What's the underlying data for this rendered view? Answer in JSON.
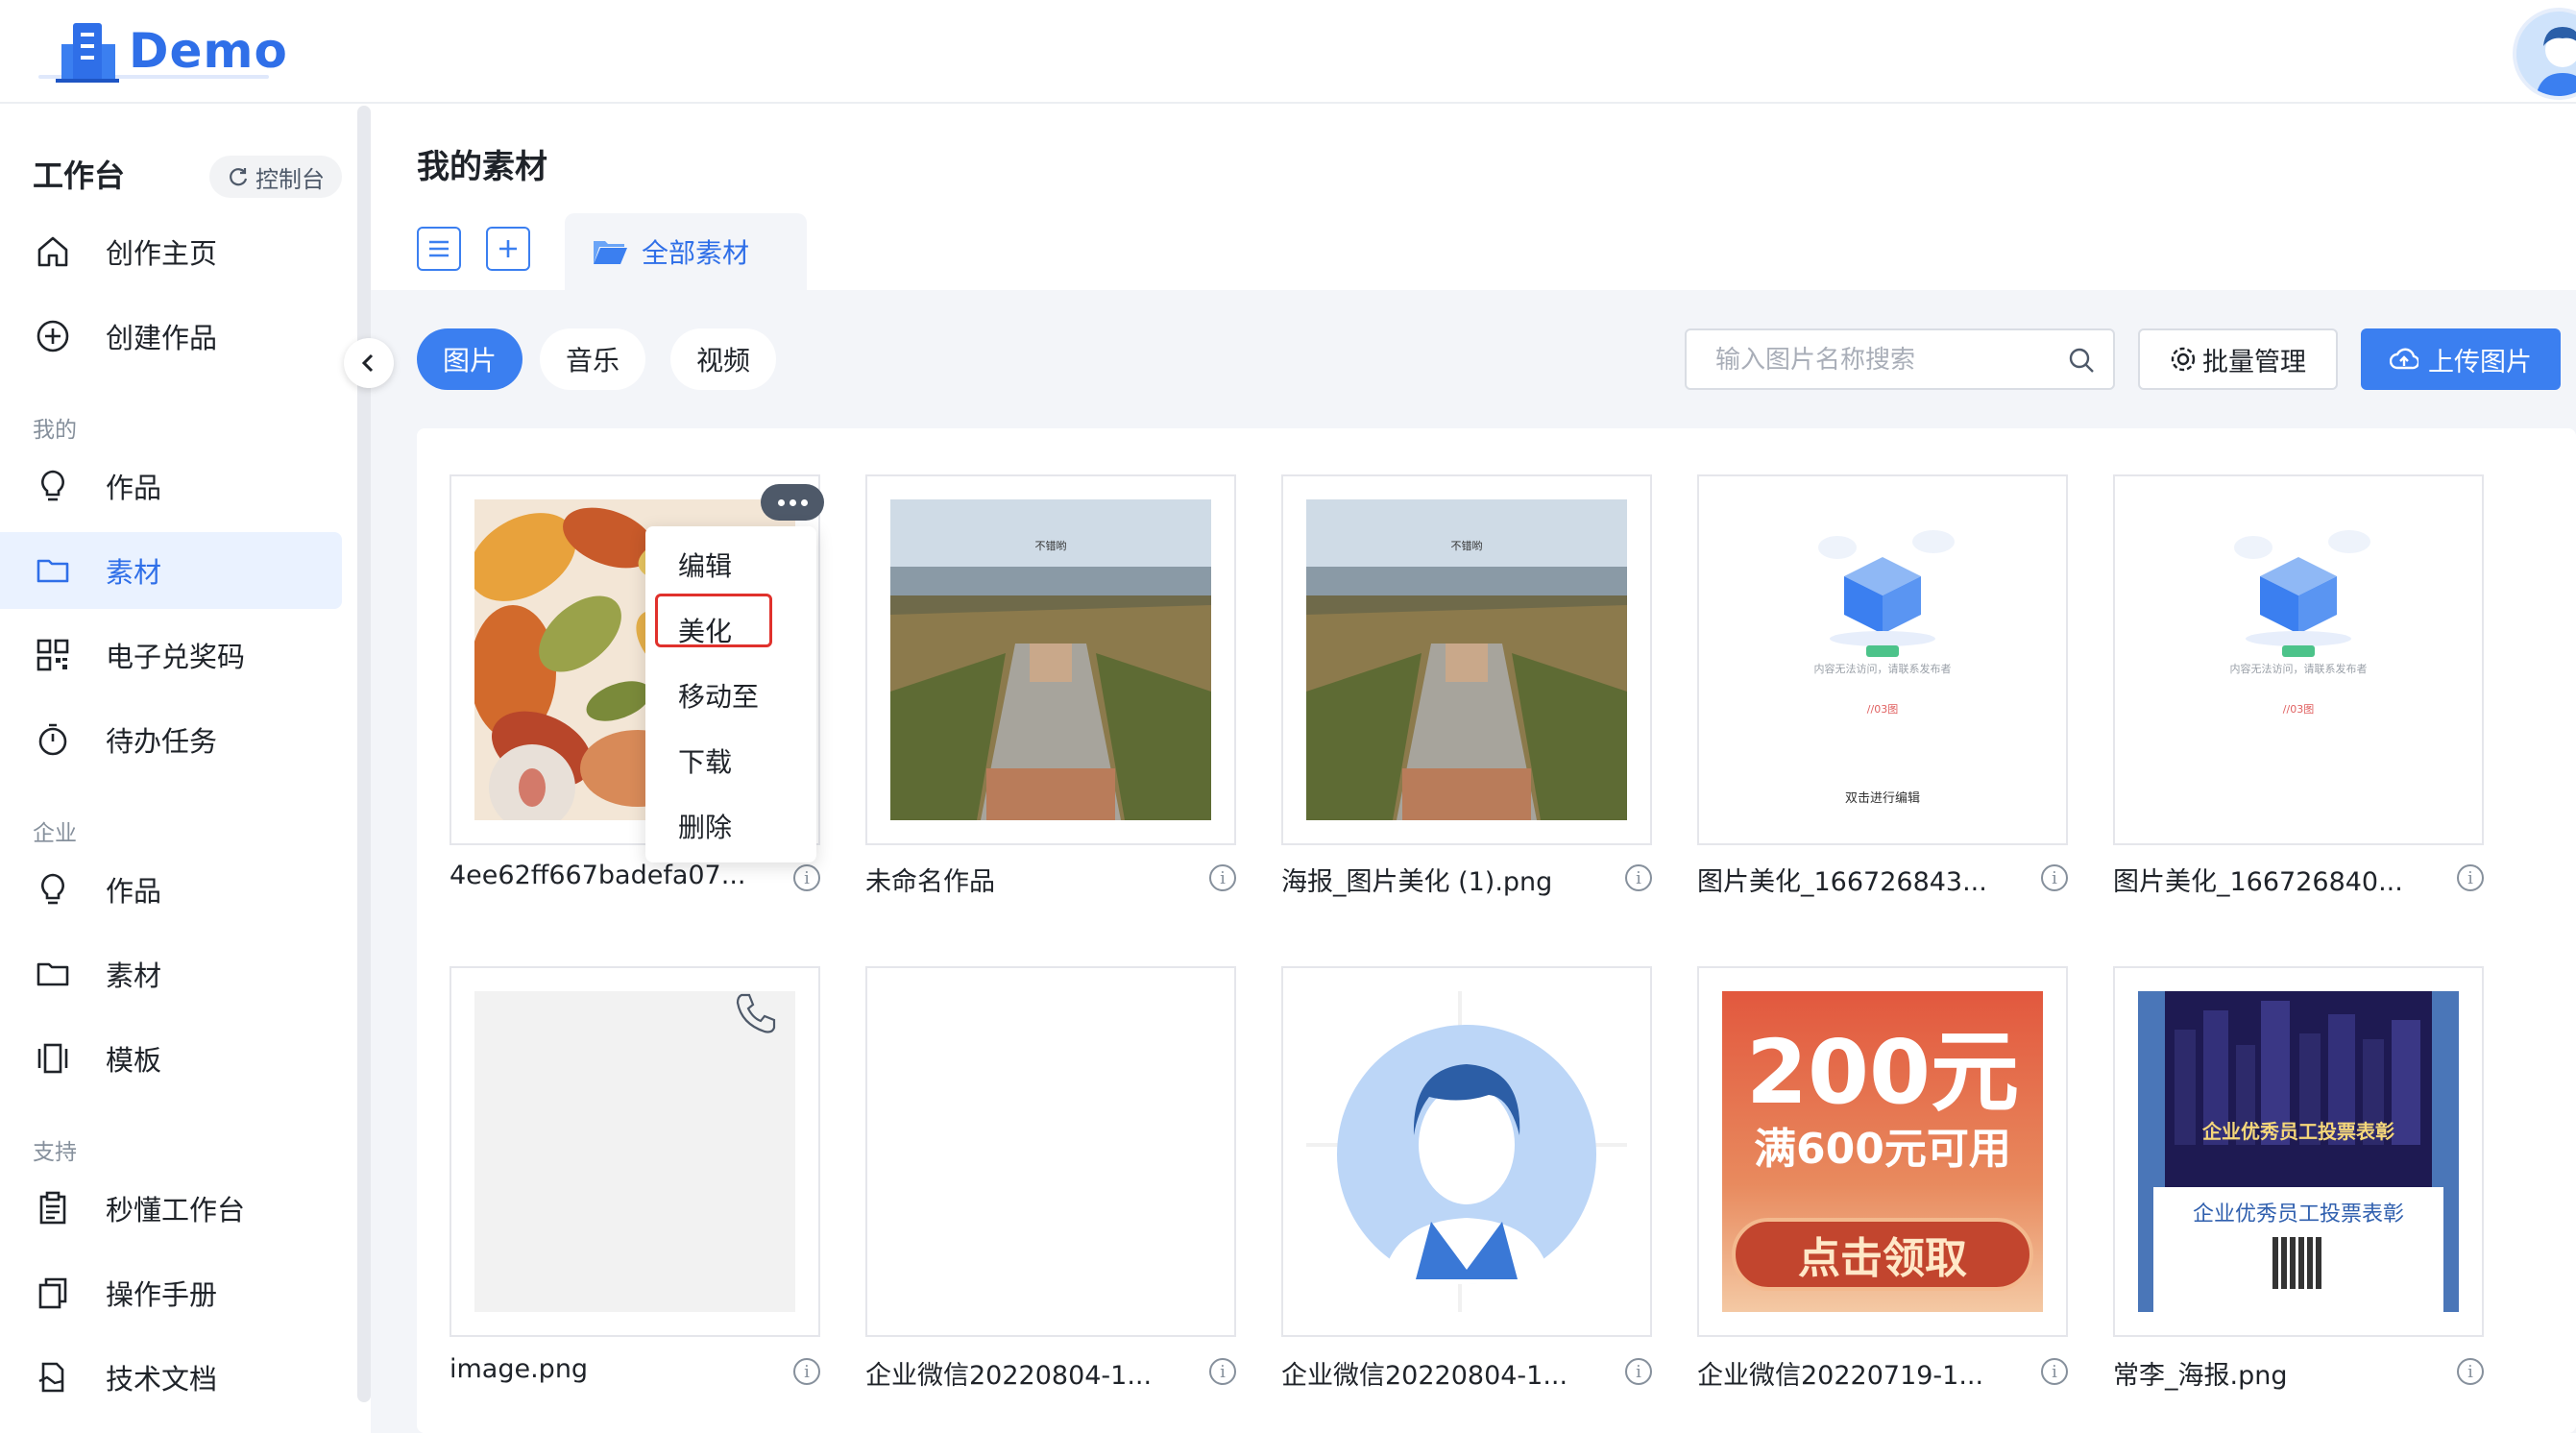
{
  "app": {
    "logo_text": "Demo"
  },
  "sidebar": {
    "title": "工作台",
    "console_label": "控制台",
    "main_items": [
      {
        "label": "创作主页"
      },
      {
        "label": "创建作品"
      }
    ],
    "sections": [
      {
        "title": "我的",
        "items": [
          {
            "label": "作品"
          },
          {
            "label": "素材",
            "active": true
          },
          {
            "label": "电子兑奖码"
          },
          {
            "label": "待办任务"
          }
        ]
      },
      {
        "title": "企业",
        "items": [
          {
            "label": "作品"
          },
          {
            "label": "素材"
          },
          {
            "label": "模板"
          }
        ]
      },
      {
        "title": "支持",
        "items": [
          {
            "label": "秒懂工作台"
          },
          {
            "label": "操作手册"
          },
          {
            "label": "技术文档"
          }
        ]
      }
    ]
  },
  "main": {
    "page_title": "我的素材",
    "folder_tab_label": "全部素材",
    "media_tabs": [
      {
        "label": "图片",
        "active": true
      },
      {
        "label": "音乐"
      },
      {
        "label": "视频"
      }
    ],
    "search": {
      "placeholder": "输入图片名称搜索",
      "value": ""
    },
    "batch_label": "批量管理",
    "upload_label": "上传图片"
  },
  "grid": {
    "rows": [
      [
        {
          "name": "4ee62ff667badefa07..."
        },
        {
          "name": "未命名作品"
        },
        {
          "name": "海报_图片美化 (1).png"
        },
        {
          "name": "图片美化_166726843..."
        },
        {
          "name": "图片美化_166726840..."
        }
      ],
      [
        {
          "name": "image.png"
        },
        {
          "name": "企业微信20220804-1..."
        },
        {
          "name": "企业微信20220804-1..."
        },
        {
          "name": "企业微信20220719-1..."
        },
        {
          "name": "常李_海报.png"
        }
      ]
    ],
    "thumb_text": {
      "aerial_caption": "不错哟",
      "empty_small_1": "内容无法访问，请联系发布者",
      "empty_small_2": "//03图",
      "empty_edit": "双击进行编辑",
      "coupon_amount": "200元",
      "coupon_cond": "满600元可用",
      "coupon_btn": "点击领取",
      "vote_title": "企业优秀员工投票表彰"
    }
  },
  "context_menu": {
    "items": [
      {
        "label": "编辑"
      },
      {
        "label": "美化",
        "highlighted": true
      },
      {
        "label": "移动至"
      },
      {
        "label": "下载"
      },
      {
        "label": "删除"
      }
    ]
  },
  "colors": {
    "accent": "#3b7ff0",
    "highlight": "#e0312c",
    "active_bg": "#eaf2ff"
  }
}
